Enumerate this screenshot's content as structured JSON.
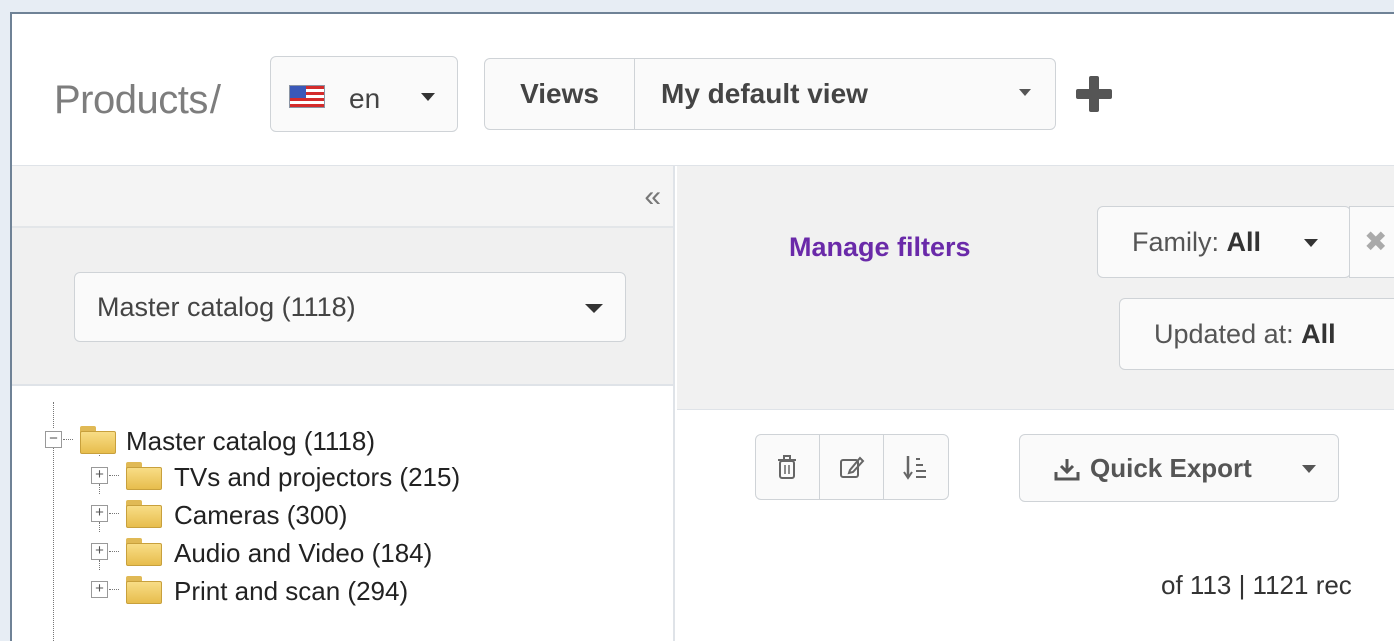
{
  "header": {
    "title": "Products",
    "separator": "/",
    "locale": {
      "label": "en",
      "flag_icon": "us-flag-icon"
    },
    "views": {
      "label": "Views",
      "selected": "My default view"
    },
    "add_view_icon": "plus-icon"
  },
  "sidebar": {
    "collapse_icon": "«",
    "tree_selector": "Master catalog (1118)",
    "tree": {
      "root": {
        "label": "Master catalog (1118)",
        "toggle": "−"
      },
      "children": [
        {
          "label": "TVs and projectors (215)",
          "toggle": "+"
        },
        {
          "label": "Cameras (300)",
          "toggle": "+"
        },
        {
          "label": "Audio and Video (184)",
          "toggle": "+"
        },
        {
          "label": "Print and scan (294)",
          "toggle": "+"
        }
      ]
    }
  },
  "filters": {
    "manage_label": "Manage filters",
    "family": {
      "prefix": "Family: ",
      "value": "All"
    },
    "remove_icon": "✖",
    "updated": {
      "prefix": "Updated at: ",
      "value": "All"
    }
  },
  "grid": {
    "mass_actions": [
      "trash-icon",
      "edit-icon",
      "sort-icon"
    ],
    "quick_export_label": "Quick Export",
    "records_info": "of 113 | 1121 rec"
  },
  "colors": {
    "accent_purple": "#6a2aa9",
    "panel_grey": "#f1f1f1",
    "border": "#cfd3d7"
  }
}
